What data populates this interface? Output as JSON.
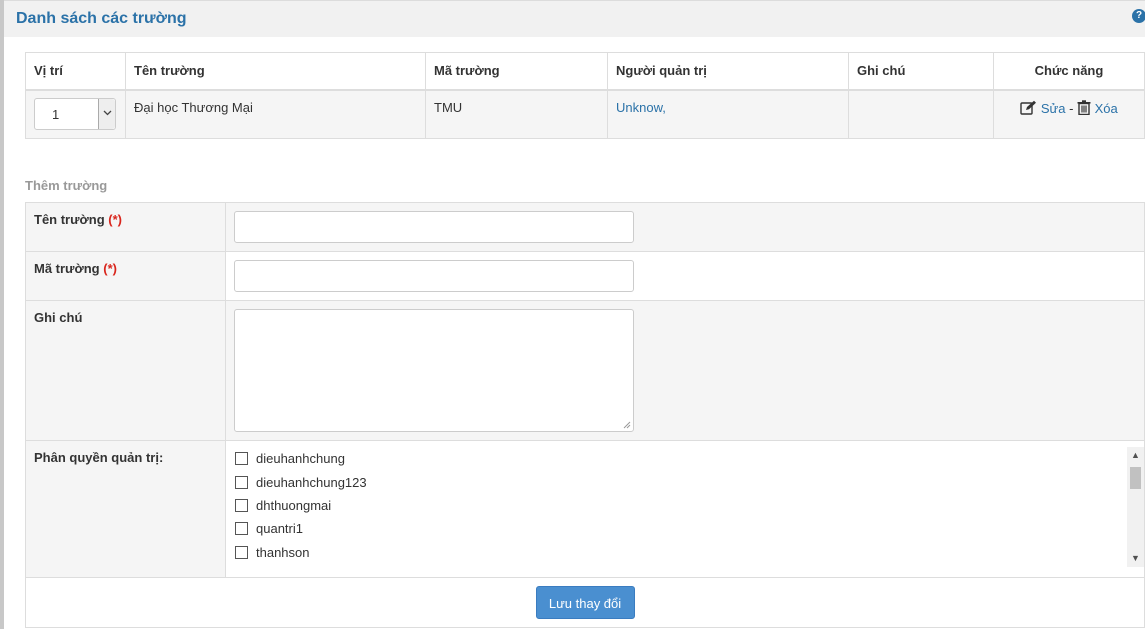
{
  "header": {
    "title": "Danh sách các trường"
  },
  "list": {
    "columns": [
      "Vị trí",
      "Tên trường",
      "Mã trường",
      "Người quản trị",
      "Ghi chú",
      "Chức năng"
    ],
    "rows": [
      {
        "position": "1",
        "name": "Đại học Thương Mại",
        "code": "TMU",
        "admin": "Unknow,",
        "note": "",
        "edit_label": "Sửa",
        "separator": " - ",
        "delete_label": "Xóa"
      }
    ]
  },
  "add_form": {
    "section_title": "Thêm trường",
    "name_label": "Tên trường",
    "code_label": "Mã trường",
    "required_mark": "(*)",
    "note_label": "Ghi chú",
    "name_value": "",
    "code_value": "",
    "note_value": "",
    "permissions_label": "Phân quyền quản trị:",
    "users": [
      "dieuhanhchung",
      "dieuhanhchung123",
      "dhthuongmai",
      "quantri1",
      "thanhson"
    ],
    "save_label": "Lưu thay đổi"
  },
  "colors": {
    "accent": "#2b72a8",
    "button": "#4a8fd0",
    "required": "#d9251c"
  }
}
